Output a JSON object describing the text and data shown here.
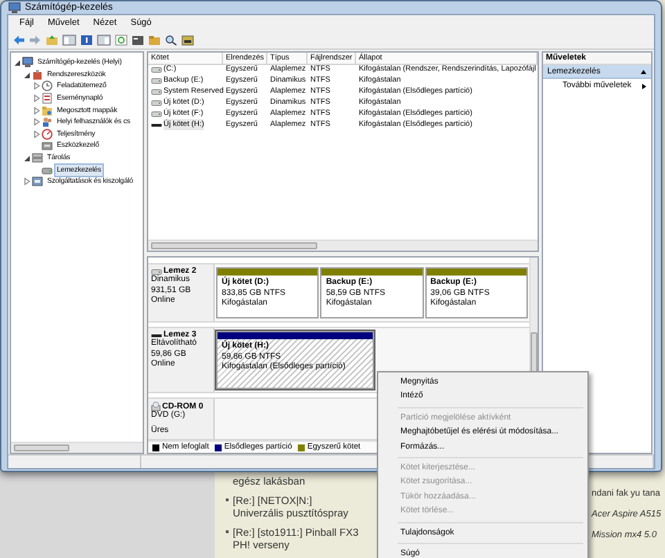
{
  "window": {
    "title": "Számítógép-kezelés"
  },
  "menu": [
    "Fájl",
    "Művelet",
    "Nézet",
    "Súgó"
  ],
  "tree": [
    {
      "label": "Számítógép-kezelés (Helyi)",
      "expanded": true,
      "selected": false,
      "children": [
        {
          "label": "Rendszereszközök",
          "expanded": true,
          "selected": false,
          "children": [
            {
              "label": "Feladatütemező",
              "expanded": false,
              "selected": false
            },
            {
              "label": "Eseménynapló",
              "expanded": false,
              "selected": false
            },
            {
              "label": "Megosztott mappák",
              "expanded": false,
              "selected": false
            },
            {
              "label": "Helyi felhasználók és cs",
              "expanded": false,
              "selected": false
            },
            {
              "label": "Teljesítmény",
              "expanded": false,
              "selected": false
            },
            {
              "label": "Eszközkezelő",
              "selected": false
            }
          ]
        },
        {
          "label": "Tárolás",
          "expanded": true,
          "selected": false,
          "children": [
            {
              "label": "Lemezkezelés",
              "selected": true
            }
          ]
        },
        {
          "label": "Szolgáltatások és kiszolgáló",
          "expanded": false,
          "selected": false
        }
      ]
    }
  ],
  "volumes": {
    "columns": [
      "Kötet",
      "Elrendezés",
      "Típus",
      "Fájlrendszer",
      "Állapot"
    ],
    "rows": [
      {
        "kind": "fixed",
        "selected": false,
        "cells": [
          "(C:)",
          "Egyszerű",
          "Alaplemez",
          "NTFS",
          "Kifogástalan (Rendszer, Rendszerindítás, Lapozófájl"
        ]
      },
      {
        "kind": "fixed",
        "selected": false,
        "cells": [
          "Backup (E:)",
          "Egyszerű",
          "Dinamikus",
          "NTFS",
          "Kifogástalan"
        ]
      },
      {
        "kind": "fixed",
        "selected": false,
        "cells": [
          "System Reserved",
          "Egyszerű",
          "Alaplemez",
          "NTFS",
          "Kifogástalan (Elsődleges partíció)"
        ]
      },
      {
        "kind": "fixed",
        "selected": false,
        "cells": [
          "Új kötet (D:)",
          "Egyszerű",
          "Dinamikus",
          "NTFS",
          "Kifogástalan"
        ]
      },
      {
        "kind": "fixed",
        "selected": false,
        "cells": [
          "Új kötet (F:)",
          "Egyszerű",
          "Alaplemez",
          "NTFS",
          "Kifogástalan (Elsődleges partíció)"
        ]
      },
      {
        "kind": "removable",
        "selected": true,
        "cells": [
          "Új kötet (H:)",
          "Egyszerű",
          "Alaplemez",
          "NTFS",
          "Kifogástalan (Elsődleges partíció)"
        ]
      }
    ]
  },
  "disks": [
    {
      "kind": "fixed",
      "name": "Lemez 2",
      "type": "Dinamikus",
      "size": "931,51 GB",
      "status": "Online",
      "partitions": [
        {
          "name": "Új kötet  (D:)",
          "size": "833,85 GB NTFS",
          "status": "Kifogástalan",
          "color": "#808000",
          "selected": false
        },
        {
          "name": "Backup  (E:)",
          "size": "58,59 GB NTFS",
          "status": "Kifogástalan",
          "color": "#808000",
          "selected": false
        },
        {
          "name": "Backup  (E:)",
          "size": "39,06 GB NTFS",
          "status": "Kifogástalan",
          "color": "#808000",
          "selected": false
        }
      ]
    },
    {
      "kind": "removable",
      "name": "Lemez 3",
      "type": "Eltávolítható",
      "size": "59,86 GB",
      "status": "Online",
      "partitions": [
        {
          "name": "Új kötet  (H:)",
          "size": "59,86 GB NTFS",
          "status": "Kifogástalan (Elsődleges partíció)",
          "color": "#00007f",
          "selected": true
        }
      ]
    },
    {
      "kind": "cdrom",
      "name": "CD-ROM 0",
      "type": "DVD (G:)",
      "status": "Üres"
    }
  ],
  "legend": [
    {
      "label": "Nem lefoglalt",
      "color": "#000000"
    },
    {
      "label": "Elsődleges partíció",
      "color": "#00007f"
    },
    {
      "label": "Egyszerű kötet",
      "color": "#808000"
    }
  ],
  "actions": {
    "title": "Műveletek",
    "section": {
      "label": "Lemezkezelés",
      "expanded": true
    },
    "items": [
      "További műveletek"
    ]
  },
  "context_menu": [
    {
      "kind": "item",
      "label": "Megnyitás",
      "disabled": false
    },
    {
      "kind": "item",
      "label": "Intéző",
      "disabled": false
    },
    {
      "kind": "separator"
    },
    {
      "kind": "item",
      "label": "Partíció megjelölése aktívként",
      "disabled": true
    },
    {
      "kind": "item",
      "label": "Meghajtóbetűjel és elérési út módosítása...",
      "disabled": false
    },
    {
      "kind": "item",
      "label": "Formázás...",
      "disabled": false
    },
    {
      "kind": "separator"
    },
    {
      "kind": "item",
      "label": "Kötet kiterjesztése...",
      "disabled": true
    },
    {
      "kind": "item",
      "label": "Kötet zsugorítása...",
      "disabled": true
    },
    {
      "kind": "item",
      "label": "Tükör hozzáadása...",
      "disabled": true
    },
    {
      "kind": "item",
      "label": "Kötet törlése...",
      "disabled": true
    },
    {
      "kind": "separator"
    },
    {
      "kind": "item",
      "label": "Tulajdonságok",
      "disabled": false
    },
    {
      "kind": "separator"
    },
    {
      "kind": "item",
      "label": "Súgó",
      "disabled": false
    }
  ],
  "background_page": {
    "left_items": [
      {
        "text": "egész lakásban",
        "bullet": false
      },
      {
        "text": "[Re:] [NETOX|N:] Univerzális pusztítóspray",
        "bullet": true
      },
      {
        "text": "[Re:] [sto1911:] Pinball FX3 PH! verseny",
        "bullet": true
      }
    ],
    "right_fragments": [
      {
        "text": "ndani fak yu tana",
        "italic": false
      },
      {
        "text": "Acer Aspire A515",
        "italic": true
      },
      {
        "text": "Mission mx4 5.0",
        "italic": true
      }
    ]
  }
}
